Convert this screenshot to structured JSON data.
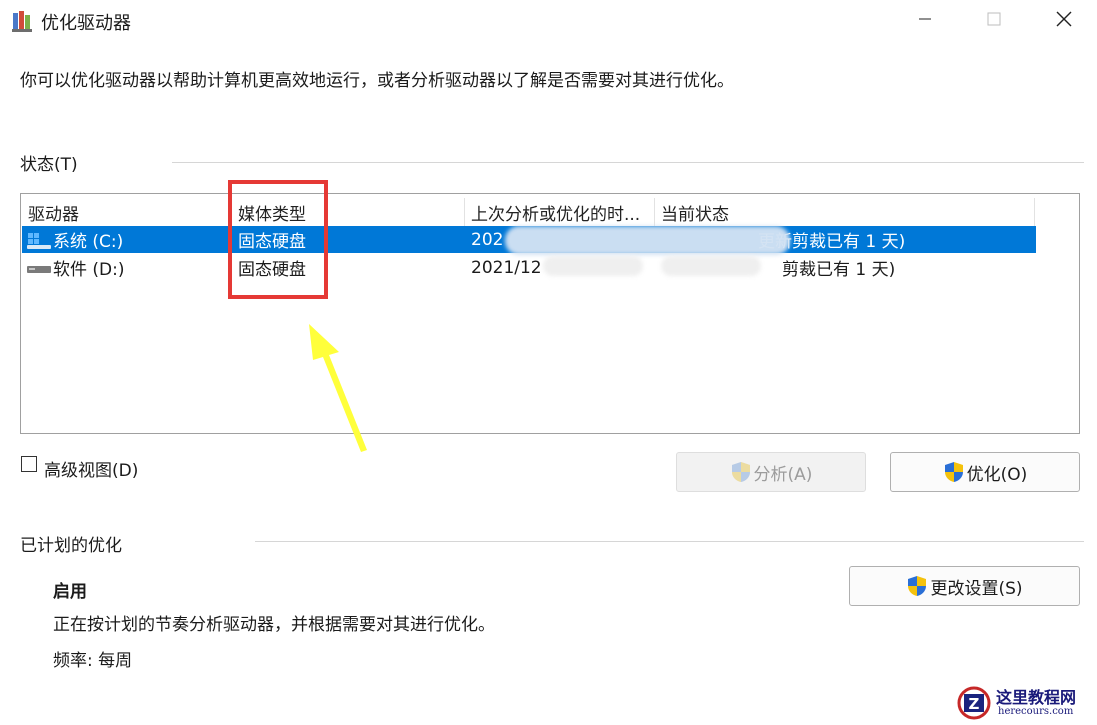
{
  "window": {
    "title": "优化驱动器"
  },
  "description": "你可以优化驱动器以帮助计算机更高效地运行，或者分析驱动器以了解是否需要对其进行优化。",
  "status_section": {
    "label": "状态(T)",
    "columns": [
      "驱动器",
      "媒体类型",
      "上次分析或优化的时...",
      "当前状态"
    ],
    "rows": [
      {
        "drive": "系统 (C:)",
        "media": "固态硬盘",
        "last": "202",
        "status": "更新剪裁已有 1 天)",
        "selected": true,
        "icon": "system-drive-icon"
      },
      {
        "drive": "软件 (D:)",
        "media": "固态硬盘",
        "last": "2021/12",
        "status": "剪裁已有 1 天)",
        "selected": false,
        "icon": "drive-icon"
      }
    ]
  },
  "advanced_view": {
    "label": "高级视图(D)",
    "checked": false
  },
  "buttons": {
    "analyze": "分析(A)",
    "optimize": "优化(O)",
    "change_settings": "更改设置(S)"
  },
  "scheduled": {
    "label": "已计划的优化",
    "state": "启用",
    "description": "正在按计划的节奏分析驱动器，并根据需要对其进行优化。",
    "frequency": "频率: 每周"
  },
  "watermark": {
    "line1": "这里教程网",
    "line2": "herecours.com"
  },
  "colors": {
    "selection": "#0078d7",
    "highlight_box": "#e53935",
    "arrow": "#ffff3b"
  }
}
